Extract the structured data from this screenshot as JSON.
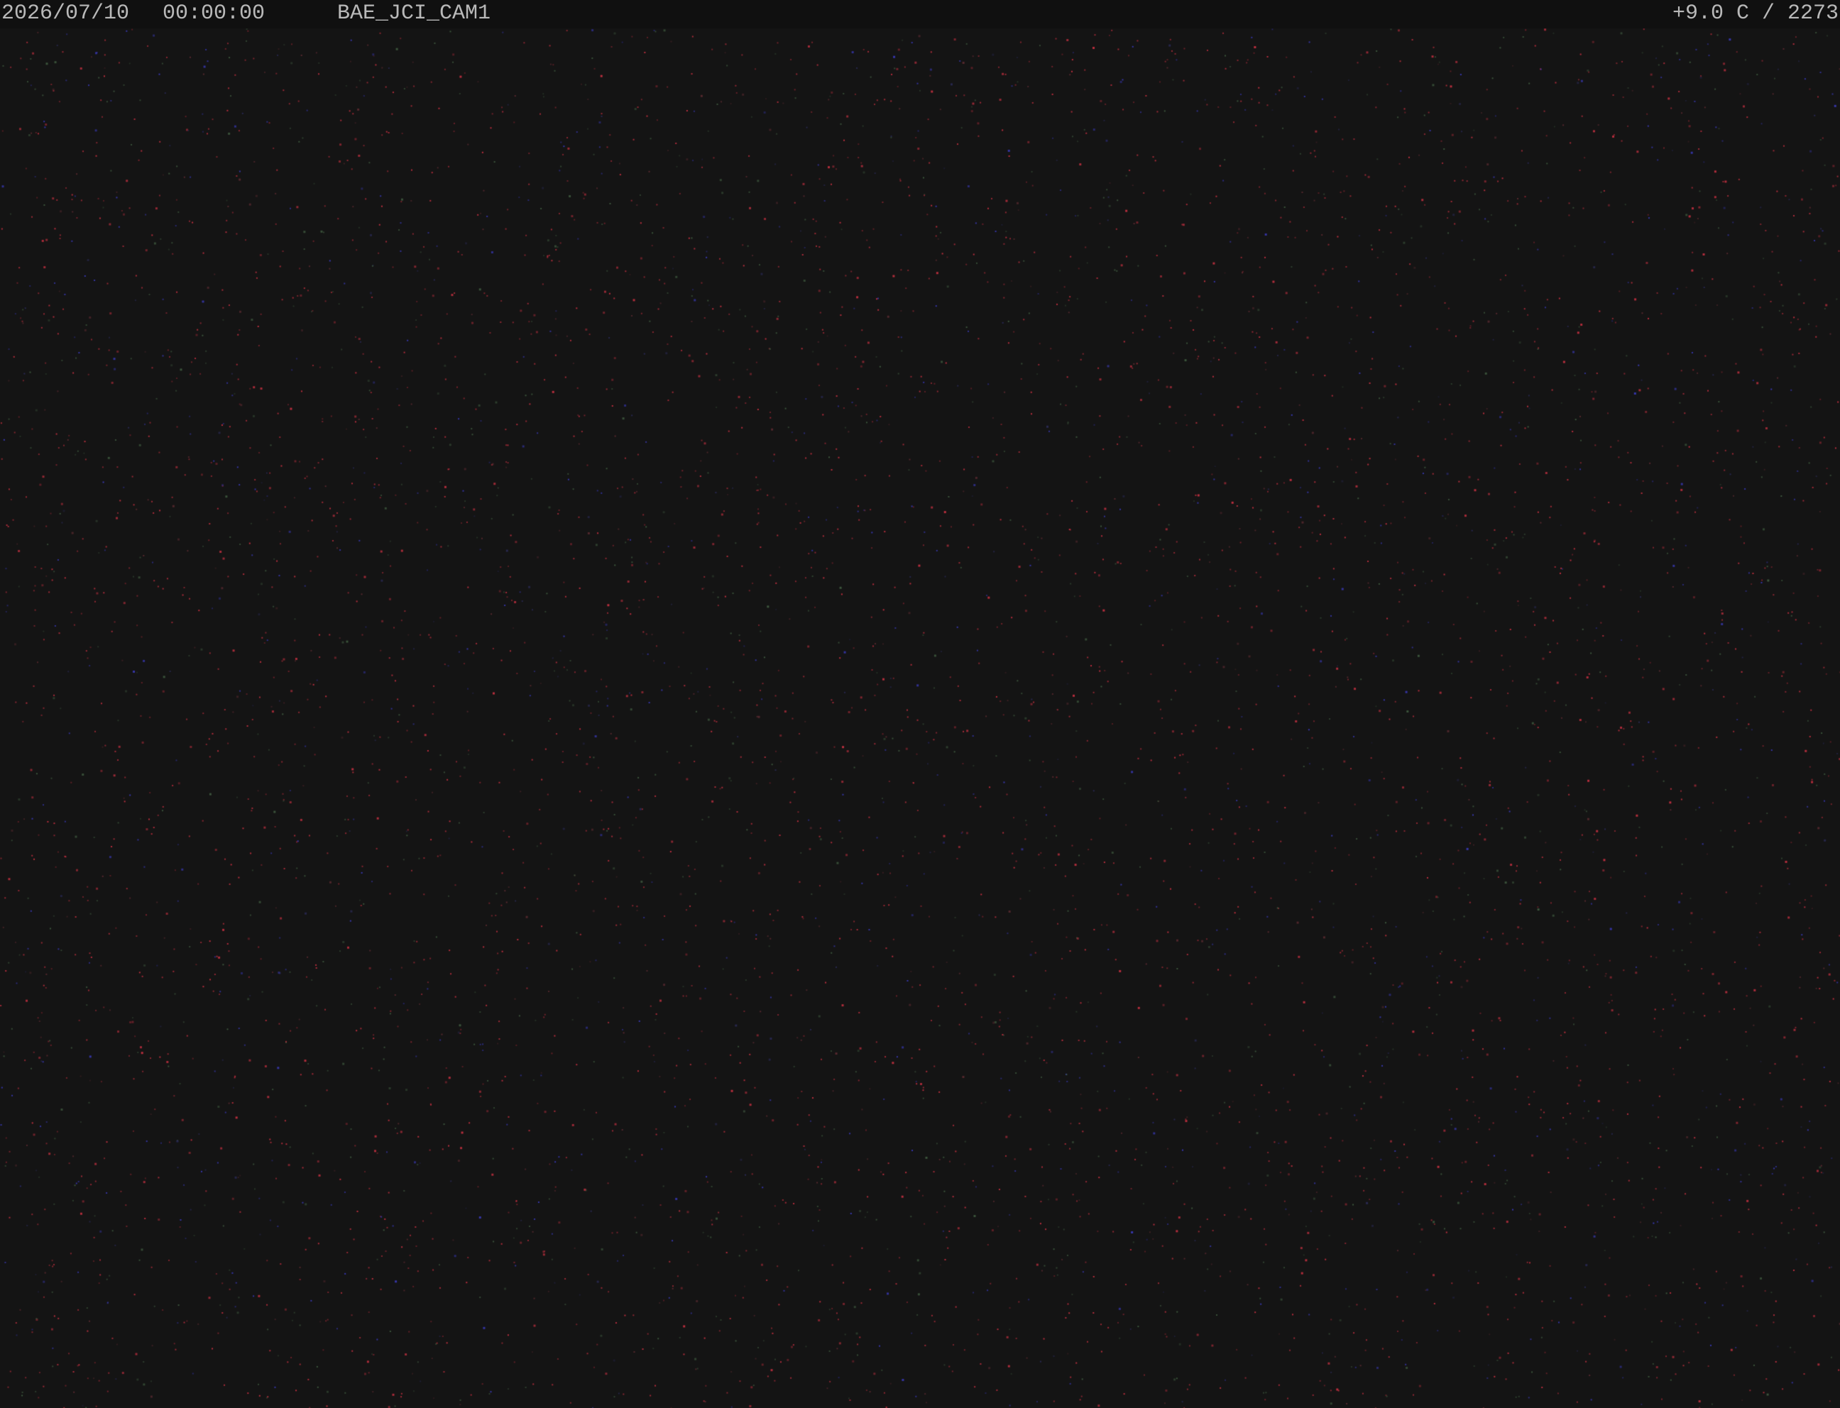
{
  "osd": {
    "date": "2026/07/10",
    "time": "00:00:00",
    "camera_name": "BAE_JCI_CAM1",
    "sensor_readout": "+9.0 C / 2273"
  },
  "colors": {
    "background": "#141414",
    "osd_bar": "#101010",
    "osd_text": "#b9b9b9",
    "noise_red": "#c23040",
    "noise_blue": "#3a3ab8",
    "noise_green": "#3f5a3f"
  }
}
